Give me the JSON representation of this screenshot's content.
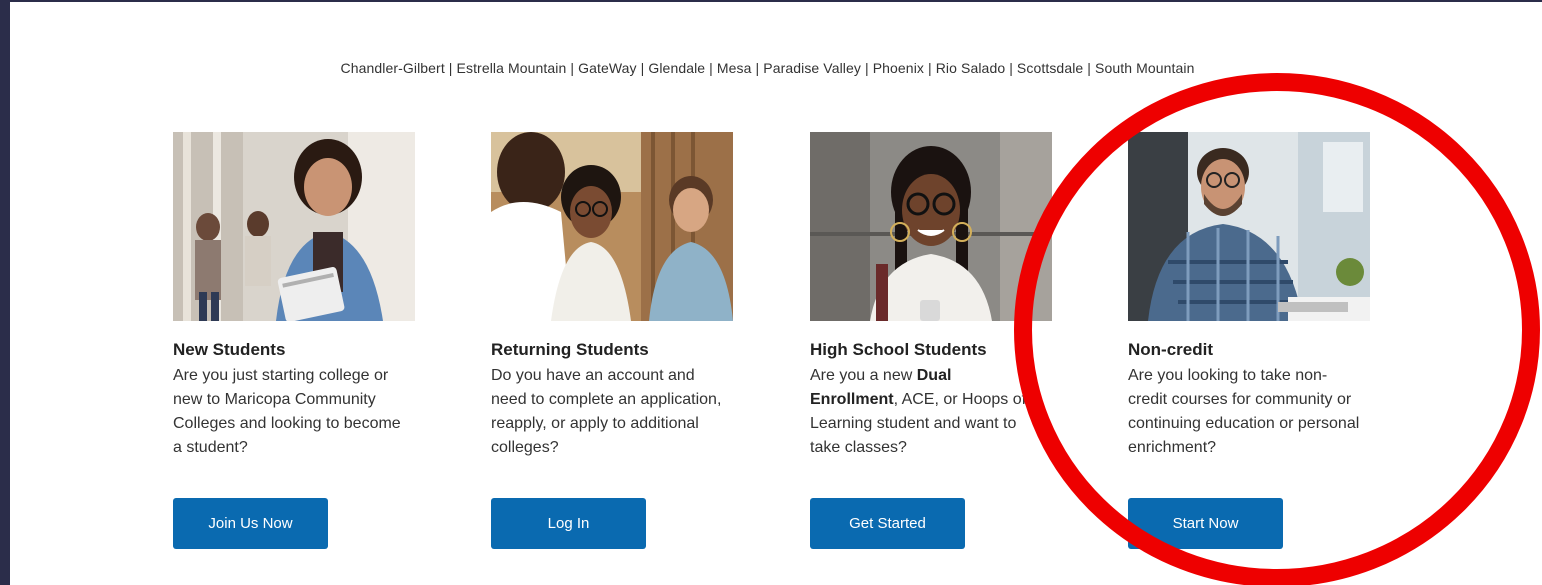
{
  "colleges_line": "Chandler-Gilbert | Estrella Mountain | GateWay | Glendale | Mesa | Paradise Valley | Phoenix | Rio Salado | Scottsdale | South Mountain",
  "cards": [
    {
      "title": "New Students",
      "description": "Are you just starting college or new to Maricopa Community Colleges and looking to become a student?",
      "button": "Join Us Now"
    },
    {
      "title": "Returning Students",
      "description": "Do you have an account and need to complete an application, reapply, or apply to additional colleges?",
      "button": "Log In"
    },
    {
      "title": "High School Students",
      "description_pre": "Are you a new ",
      "description_bold": "Dual Enrollment",
      "description_post": ", ACE, or Hoops of Learning student and want to take classes?",
      "button": "Get Started"
    },
    {
      "title": "Non-credit",
      "description": "Are you looking to take non-credit courses for community or continuing education or personal enrichment?",
      "button": "Start Now"
    }
  ],
  "colors": {
    "outer_bg": "#2b2d4a",
    "button_bg": "#0a6ab0",
    "annotation_circle": "#ee0000"
  }
}
